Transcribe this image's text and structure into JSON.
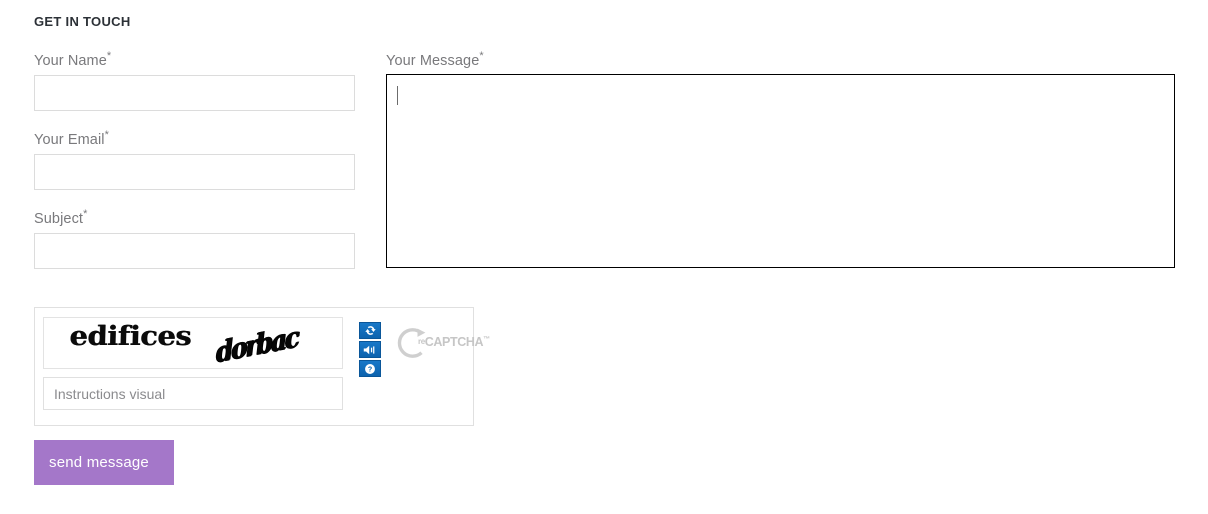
{
  "section": {
    "title": "GET IN TOUCH"
  },
  "fields": {
    "name": {
      "label": "Your Name",
      "required_mark": "*",
      "value": "",
      "placeholder": ""
    },
    "email": {
      "label": "Your Email",
      "required_mark": "*",
      "value": "",
      "placeholder": ""
    },
    "subject": {
      "label": "Subject",
      "required_mark": "*",
      "value": "",
      "placeholder": ""
    },
    "message": {
      "label": "Your Message",
      "required_mark": "*",
      "value": "",
      "placeholder": "",
      "focused": true
    }
  },
  "captcha": {
    "word_1": "edifices",
    "word_2": "dorbac",
    "answer_value": "",
    "answer_placeholder": "Instructions visual",
    "brand_prefix": "re",
    "brand_name": "CAPTCHA",
    "brand_tm": "™",
    "buttons": [
      {
        "name": "refresh-icon",
        "title": "Get a new challenge"
      },
      {
        "name": "audio-icon",
        "title": "Get an audio challenge"
      },
      {
        "name": "help-icon",
        "title": "Help"
      }
    ]
  },
  "submit": {
    "label": "send message"
  },
  "colors": {
    "accent_purple": "#a477c9",
    "captcha_blue": "#1170bf",
    "brand_gray": "#c6c6c6",
    "label_gray": "#79797c",
    "title_dark": "#2c3137",
    "input_border": "#dcdcdc",
    "focus_border": "#000000"
  }
}
